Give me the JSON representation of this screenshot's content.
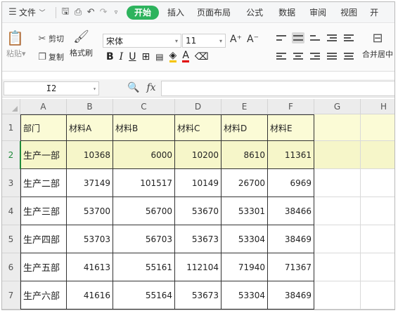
{
  "menubar": {
    "file_label": "文件",
    "tabs": [
      "开始",
      "插入",
      "页面布局",
      "公式",
      "数据",
      "审阅",
      "视图",
      "开"
    ],
    "active_tab": "开始"
  },
  "ribbon": {
    "paste_label": "粘贴",
    "cut_label": "剪切",
    "copy_label": "复制",
    "format_painter_label": "格式刷",
    "font_name": "宋体",
    "font_size": "11",
    "grow_font": "A⁺",
    "shrink_font": "A⁻",
    "bold": "B",
    "italic": "I",
    "underline": "U",
    "merge_label": "合并居中"
  },
  "formula_bar": {
    "cell_ref": "I2",
    "fx_label": "fx",
    "value": ""
  },
  "sheet": {
    "columns": [
      "A",
      "B",
      "C",
      "D",
      "E",
      "F",
      "G",
      "H"
    ],
    "rows": [
      "1",
      "2",
      "3",
      "4",
      "5",
      "6",
      "7"
    ],
    "header_row": [
      "部门",
      "材料A",
      "材料B",
      "材料C",
      "材料D",
      "材料E"
    ],
    "data": [
      [
        "生产一部",
        "10368",
        "6000",
        "10200",
        "8610",
        "11361"
      ],
      [
        "生产二部",
        "37149",
        "101517",
        "10149",
        "26700",
        "6969"
      ],
      [
        "生产三部",
        "53700",
        "56700",
        "53670",
        "53301",
        "38466"
      ],
      [
        "生产四部",
        "53703",
        "56703",
        "53673",
        "53304",
        "38469"
      ],
      [
        "生产五部",
        "41613",
        "55161",
        "112104",
        "71940",
        "71367"
      ],
      [
        "生产六部",
        "41616",
        "55164",
        "53673",
        "53304",
        "38469"
      ]
    ]
  },
  "colors": {
    "accent": "#2db35d",
    "highlight_row": "#fbfbd6",
    "selection_border": "#1f8a3a"
  }
}
